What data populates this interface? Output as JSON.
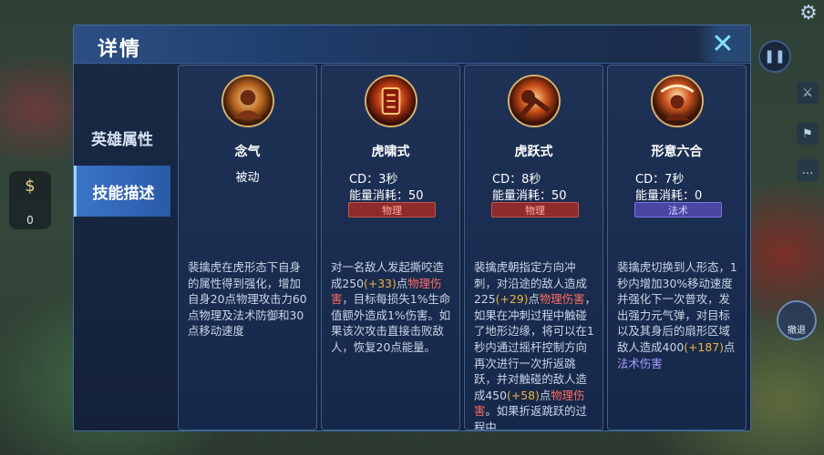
{
  "window": {
    "title": "详情",
    "close_icon": "close-x-icon"
  },
  "tabs": [
    {
      "label": "英雄属性",
      "active": false
    },
    {
      "label": "技能描述",
      "active": true
    }
  ],
  "hud": {
    "gold_amount": "0",
    "jump_label": "撤退"
  },
  "skills": [
    {
      "name": "念气",
      "passive_label": "被动",
      "icon": "skill-nianqi-icon",
      "desc": [
        {
          "t": "裴擒虎在虎形态下自身的属性得到强化，增加自身20点物理攻击力60点物理及法术防御和30点移动速度",
          "c": ""
        }
      ]
    },
    {
      "name": "虎啸式",
      "cd": "CD：3秒",
      "energy": "能量消耗：50",
      "damage_type": "物理",
      "icon": "skill-huxiaoshi-icon",
      "desc": [
        {
          "t": "对一名敌人发起撕咬造成250",
          "c": ""
        },
        {
          "t": "(+33)",
          "c": "y"
        },
        {
          "t": "点",
          "c": ""
        },
        {
          "t": "物理伤害",
          "c": "r"
        },
        {
          "t": "，目标每损失1%生命值额外造成1%伤害。如果该次攻击直接击败敌人，恢复20点能量。",
          "c": ""
        }
      ]
    },
    {
      "name": "虎跃式",
      "cd": "CD：8秒",
      "energy": "能量消耗：50",
      "damage_type": "物理",
      "icon": "skill-huyueshi-icon",
      "desc": [
        {
          "t": "裴擒虎朝指定方向冲刺，对沿途的敌人造成225",
          "c": ""
        },
        {
          "t": "(+29)",
          "c": "y"
        },
        {
          "t": "点",
          "c": ""
        },
        {
          "t": "物理伤害",
          "c": "r"
        },
        {
          "t": "，如果在冲刺过程中触碰了地形边缘，将可以在1秒内通过摇杆控制方向再次进行一次折返跳跃，并对触碰的敌人造成450",
          "c": ""
        },
        {
          "t": "(+58)",
          "c": "y"
        },
        {
          "t": "点",
          "c": ""
        },
        {
          "t": "物理伤害",
          "c": "r"
        },
        {
          "t": "。如果折返跳跃的过程中",
          "c": ""
        }
      ]
    },
    {
      "name": "形意六合",
      "cd": "CD：7秒",
      "energy": "能量消耗：0",
      "damage_type": "法术",
      "icon": "skill-xingyiliuhe-icon",
      "desc": [
        {
          "t": "裴擒虎切换到人形态，1秒内增加30%移动速度并强化下一次普攻，发出强力元气弹，对目标以及其身后的扇形区域敌人造成400",
          "c": ""
        },
        {
          "t": "(+187)",
          "c": "y"
        },
        {
          "t": "点",
          "c": ""
        },
        {
          "t": "法术伤害",
          "c": "p"
        }
      ]
    }
  ],
  "colors": {
    "accent": "#3b74c8",
    "physical": "#8f2b2b",
    "magic": "#4b45a3",
    "scaling": "#f0b43b"
  }
}
